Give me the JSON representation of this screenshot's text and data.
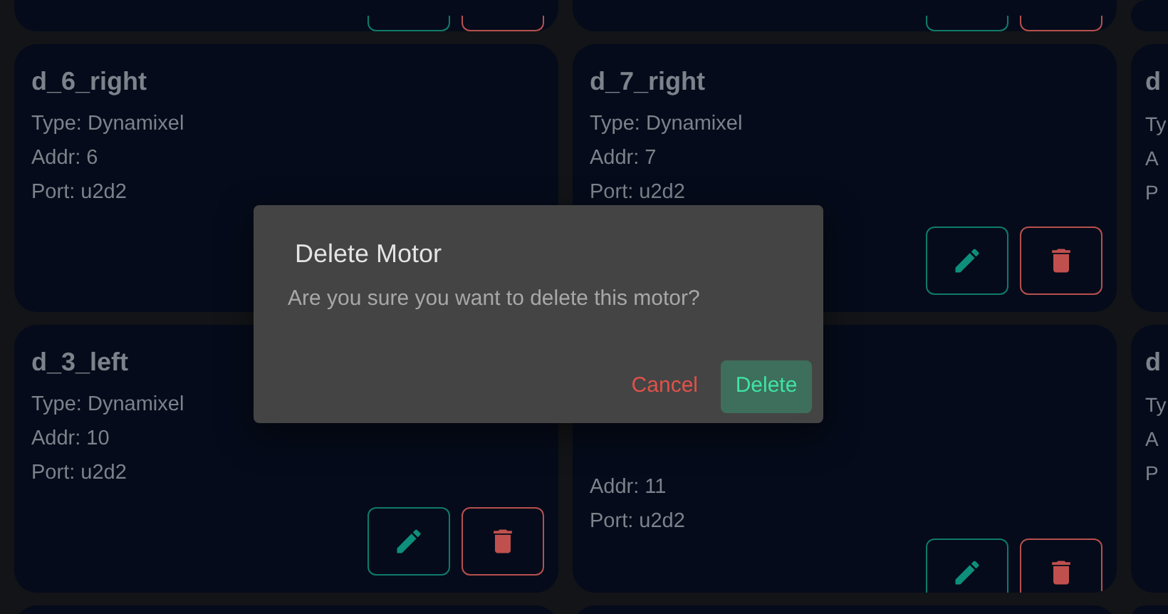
{
  "rows": [
    {
      "cards": [
        {
          "actions": true
        },
        {
          "actions": true
        },
        {
          "actions": false
        }
      ]
    },
    {
      "cards": [
        {
          "title": "d_6_right",
          "lines": [
            "Type: Dynamixel",
            "Addr: 6",
            "Port: u2d2"
          ]
        },
        {
          "title": "d_7_right",
          "lines": [
            "Type: Dynamixel",
            "Addr: 7",
            "Port: u2d2"
          ],
          "actions": true
        },
        {
          "title": "d",
          "lines": [
            "Ty",
            "A",
            "P"
          ],
          "actions": false
        }
      ]
    },
    {
      "cards": [
        {
          "title": "d_3_left",
          "lines": [
            "Type: Dynamixel",
            "Addr: 10",
            "Port: u2d2"
          ],
          "actions": true
        },
        {
          "lines": [
            "Addr: 11",
            "Port: u2d2"
          ],
          "hidden_top": true,
          "actions": true
        },
        {
          "title": "d",
          "lines": [
            "Ty",
            "A",
            "P"
          ],
          "actions": false
        }
      ]
    },
    {
      "cards": [
        {
          "actions": false
        },
        {
          "actions": false
        },
        {
          "actions": false
        }
      ]
    }
  ],
  "dialog": {
    "title": "Delete Motor",
    "message": "Are you sure you want to delete this motor?",
    "cancel": "Cancel",
    "confirm": "Delete"
  }
}
